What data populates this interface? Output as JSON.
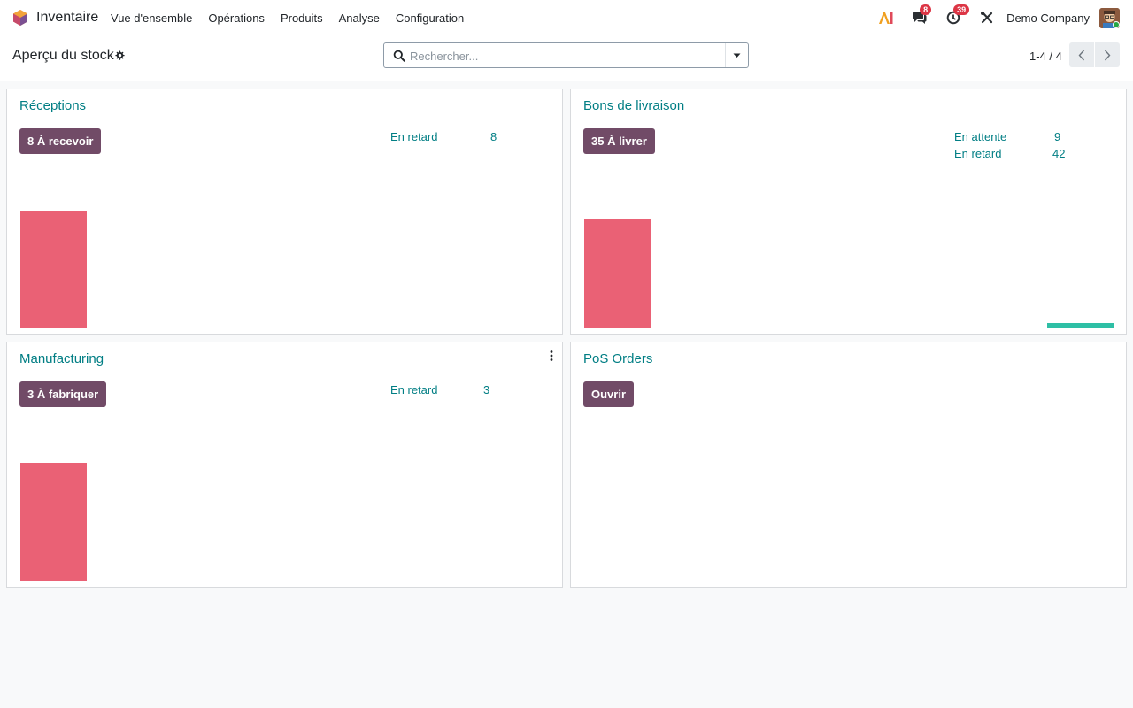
{
  "navbar": {
    "app_name": "Inventaire",
    "menu": [
      "Vue d'ensemble",
      "Opérations",
      "Produits",
      "Analyse",
      "Configuration"
    ],
    "messages_count": "8",
    "activities_count": "39",
    "company": "Demo Company"
  },
  "control_panel": {
    "title": "Aperçu du stock",
    "search_placeholder": "Rechercher...",
    "pager": "1-4 / 4"
  },
  "cards": {
    "receptions": {
      "title": "Réceptions",
      "button": "8 À recevoir",
      "stats": [
        {
          "label": "En retard",
          "value": "8"
        }
      ]
    },
    "deliveries": {
      "title": "Bons de livraison",
      "button": "35 À livrer",
      "stats": [
        {
          "label": "En attente",
          "value": "9"
        },
        {
          "label": "En retard",
          "value": "42"
        }
      ]
    },
    "manufacturing": {
      "title": "Manufacturing",
      "button": "3 À fabriquer",
      "stats": [
        {
          "label": "En retard",
          "value": "3"
        }
      ]
    },
    "pos": {
      "title": "PoS Orders",
      "button": "Ouvrir"
    }
  },
  "colors": {
    "accent": "#017e84",
    "primary_button": "#714b67",
    "bar_red": "#ea6175",
    "bar_teal": "#2ebfa5"
  }
}
